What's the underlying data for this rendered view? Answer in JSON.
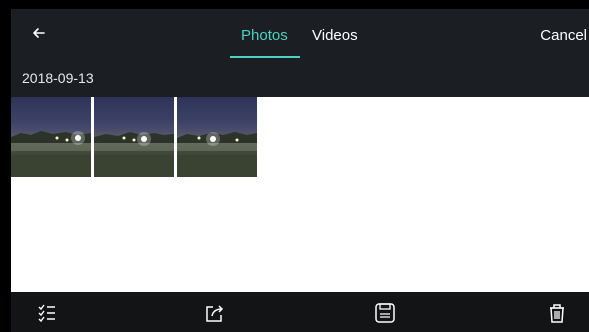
{
  "header": {
    "tabs": [
      {
        "label": "Photos",
        "active": true
      },
      {
        "label": "Videos",
        "active": false
      }
    ],
    "cancel_label": "Cancel",
    "back_icon": "arrow-left-icon"
  },
  "gallery": {
    "date": "2018-09-13",
    "photo_count": 3
  },
  "toolbar": {
    "icons": [
      "select-list-icon",
      "share-icon",
      "save-icon",
      "trash-icon"
    ]
  },
  "colors": {
    "accent": "#4fd0c0",
    "bar_bg": "#1b1f24",
    "bottom_bg": "#121416",
    "content_bg": "#ffffff"
  }
}
